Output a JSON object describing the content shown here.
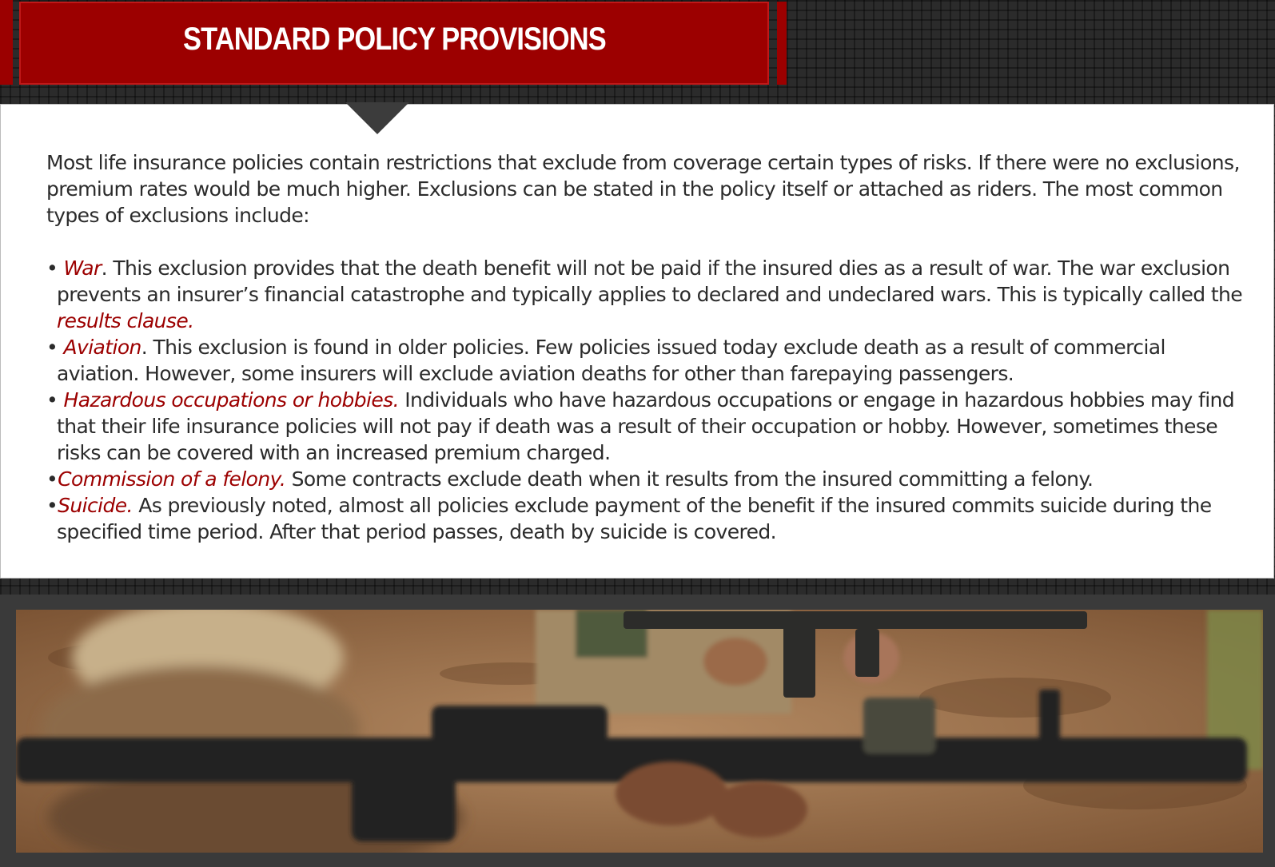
{
  "header": {
    "title": "STANDARD POLICY PROVISIONS"
  },
  "body": {
    "intro": "Most life insurance policies contain restrictions that exclude from coverage certain types of risks. If there were no exclusions, premium rates would be much higher. Exclusions can be stated in the policy itself or attached as riders. The most common types of exclusions include:",
    "exclusions": [
      {
        "bullet": "•",
        "term": "War",
        "text": ". This exclusion provides that the death benefit will not be paid if the insured dies as a result of war. The war exclusion prevents an insurer’s financial catastrophe and typically applies to declared and undeclared wars. This is typically called the ",
        "emphasis": "results clause."
      },
      {
        "bullet": "•",
        "term": "Aviation",
        "text": ". This exclusion is found in older policies. Few policies issued today exclude death as a result of commercial aviation. However, some insurers will exclude aviation deaths for other than farepaying passengers."
      },
      {
        "bullet": "•",
        "term": "Hazardous occupations or hobbies.",
        "text": " Individuals who have hazardous occupations or engage in hazardous hobbies may find that their life insurance policies will not pay if death was a result of their occupation or hobby. However, sometimes these risks can be covered with an increased premium charged."
      },
      {
        "bullet": "•",
        "term": "Commission of a felony.",
        "text": " Some contracts exclude death when it results from the insured committing a felony."
      },
      {
        "bullet": "•",
        "term": "Suicide.",
        "text": " As previously noted, almost all policies exclude payment of the benefit if the insured commits suicide during the specified time period. After that period passes, death by suicide is covered."
      }
    ]
  },
  "colors": {
    "accent": "#9c0000",
    "text": "#2b2b2b",
    "background": "#2b2b2b",
    "card": "#ffffff"
  }
}
